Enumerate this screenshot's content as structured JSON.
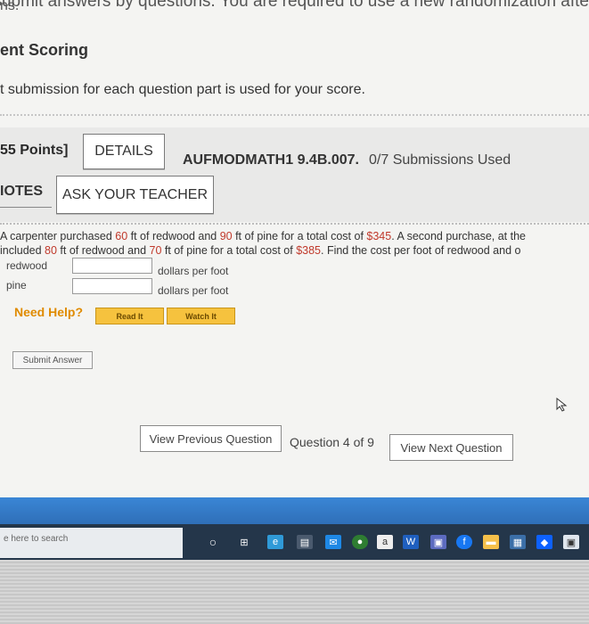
{
  "top": {
    "cut_left": "ns.",
    "cut_right": "gnment, you submit answers by questions. You are required to use a new randomization afte"
  },
  "scoring": {
    "title": "ent Scoring",
    "description": "t submission for each question part is used for your score."
  },
  "question": {
    "points": "55 Points]",
    "details_label": "DETAILS",
    "code": "AUFMODMATH1 9.4B.007.",
    "submissions": "0/7 Submissions Used",
    "notes_label": "IOTES",
    "ask_teacher_label": "ASK YOUR TEACHER",
    "text": {
      "p1": "A carpenter purchased ",
      "v1": "60",
      "p2": " ft of redwood and ",
      "v2": "90",
      "p3": " ft of pine for a total cost of ",
      "v3": "$345",
      "p4": ". A second purchase, at the",
      "p5": "included ",
      "v4": "80",
      "p6": " ft of redwood and ",
      "v5": "70",
      "p7": " ft of pine for a total cost of ",
      "v6": "$385",
      "p8": ". Find the cost per foot of redwood and o"
    },
    "fields": [
      {
        "label": "redwood",
        "value": "",
        "unit": "dollars per foot"
      },
      {
        "label": "pine",
        "value": "",
        "unit": "dollars per foot"
      }
    ],
    "need_help": "Need Help?",
    "read_it": "Read It",
    "watch_it": "Watch It",
    "submit_label": "Submit Answer"
  },
  "navigation": {
    "prev_label": "View Previous Question",
    "counter": "Question 4 of 9",
    "next_label": "View Next Question"
  },
  "taskbar": {
    "search_placeholder": "e here to search",
    "icons": [
      "cortana-icon",
      "task-view-icon",
      "edge-icon",
      "store-icon",
      "mail-icon",
      "chrome-icon",
      "amazon-icon",
      "word-icon",
      "app-icon",
      "facebook-icon",
      "folder-icon",
      "app-icon",
      "dropbox-icon",
      "app-icon"
    ]
  },
  "colors": {
    "accent_red": "#c0392b",
    "help_orange": "#e08b00",
    "taskbar": "#24364a",
    "blue_bar": "#2f6fb8"
  }
}
